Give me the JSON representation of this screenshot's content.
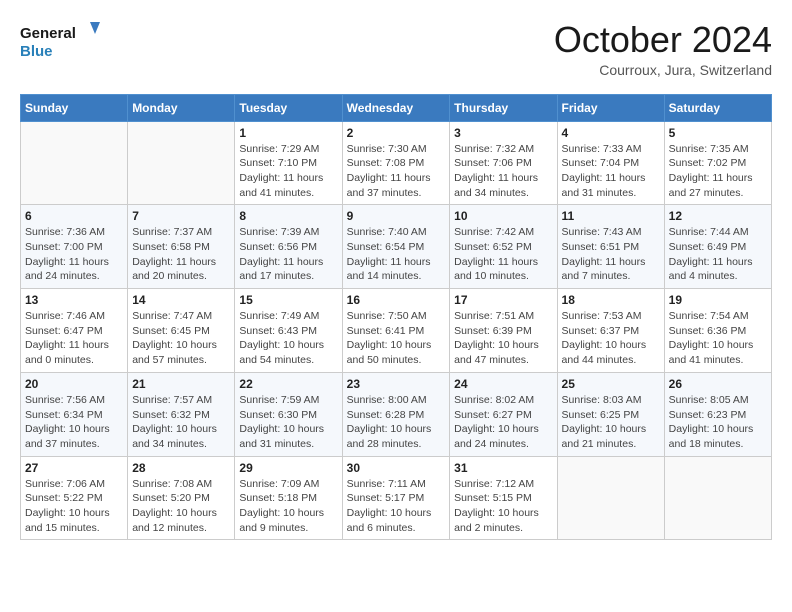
{
  "header": {
    "logo_line1": "General",
    "logo_line2": "Blue",
    "month": "October 2024",
    "location": "Courroux, Jura, Switzerland"
  },
  "weekdays": [
    "Sunday",
    "Monday",
    "Tuesday",
    "Wednesday",
    "Thursday",
    "Friday",
    "Saturday"
  ],
  "weeks": [
    [
      {
        "day": "",
        "info": ""
      },
      {
        "day": "",
        "info": ""
      },
      {
        "day": "1",
        "info": "Sunrise: 7:29 AM\nSunset: 7:10 PM\nDaylight: 11 hours and 41 minutes."
      },
      {
        "day": "2",
        "info": "Sunrise: 7:30 AM\nSunset: 7:08 PM\nDaylight: 11 hours and 37 minutes."
      },
      {
        "day": "3",
        "info": "Sunrise: 7:32 AM\nSunset: 7:06 PM\nDaylight: 11 hours and 34 minutes."
      },
      {
        "day": "4",
        "info": "Sunrise: 7:33 AM\nSunset: 7:04 PM\nDaylight: 11 hours and 31 minutes."
      },
      {
        "day": "5",
        "info": "Sunrise: 7:35 AM\nSunset: 7:02 PM\nDaylight: 11 hours and 27 minutes."
      }
    ],
    [
      {
        "day": "6",
        "info": "Sunrise: 7:36 AM\nSunset: 7:00 PM\nDaylight: 11 hours and 24 minutes."
      },
      {
        "day": "7",
        "info": "Sunrise: 7:37 AM\nSunset: 6:58 PM\nDaylight: 11 hours and 20 minutes."
      },
      {
        "day": "8",
        "info": "Sunrise: 7:39 AM\nSunset: 6:56 PM\nDaylight: 11 hours and 17 minutes."
      },
      {
        "day": "9",
        "info": "Sunrise: 7:40 AM\nSunset: 6:54 PM\nDaylight: 11 hours and 14 minutes."
      },
      {
        "day": "10",
        "info": "Sunrise: 7:42 AM\nSunset: 6:52 PM\nDaylight: 11 hours and 10 minutes."
      },
      {
        "day": "11",
        "info": "Sunrise: 7:43 AM\nSunset: 6:51 PM\nDaylight: 11 hours and 7 minutes."
      },
      {
        "day": "12",
        "info": "Sunrise: 7:44 AM\nSunset: 6:49 PM\nDaylight: 11 hours and 4 minutes."
      }
    ],
    [
      {
        "day": "13",
        "info": "Sunrise: 7:46 AM\nSunset: 6:47 PM\nDaylight: 11 hours and 0 minutes."
      },
      {
        "day": "14",
        "info": "Sunrise: 7:47 AM\nSunset: 6:45 PM\nDaylight: 10 hours and 57 minutes."
      },
      {
        "day": "15",
        "info": "Sunrise: 7:49 AM\nSunset: 6:43 PM\nDaylight: 10 hours and 54 minutes."
      },
      {
        "day": "16",
        "info": "Sunrise: 7:50 AM\nSunset: 6:41 PM\nDaylight: 10 hours and 50 minutes."
      },
      {
        "day": "17",
        "info": "Sunrise: 7:51 AM\nSunset: 6:39 PM\nDaylight: 10 hours and 47 minutes."
      },
      {
        "day": "18",
        "info": "Sunrise: 7:53 AM\nSunset: 6:37 PM\nDaylight: 10 hours and 44 minutes."
      },
      {
        "day": "19",
        "info": "Sunrise: 7:54 AM\nSunset: 6:36 PM\nDaylight: 10 hours and 41 minutes."
      }
    ],
    [
      {
        "day": "20",
        "info": "Sunrise: 7:56 AM\nSunset: 6:34 PM\nDaylight: 10 hours and 37 minutes."
      },
      {
        "day": "21",
        "info": "Sunrise: 7:57 AM\nSunset: 6:32 PM\nDaylight: 10 hours and 34 minutes."
      },
      {
        "day": "22",
        "info": "Sunrise: 7:59 AM\nSunset: 6:30 PM\nDaylight: 10 hours and 31 minutes."
      },
      {
        "day": "23",
        "info": "Sunrise: 8:00 AM\nSunset: 6:28 PM\nDaylight: 10 hours and 28 minutes."
      },
      {
        "day": "24",
        "info": "Sunrise: 8:02 AM\nSunset: 6:27 PM\nDaylight: 10 hours and 24 minutes."
      },
      {
        "day": "25",
        "info": "Sunrise: 8:03 AM\nSunset: 6:25 PM\nDaylight: 10 hours and 21 minutes."
      },
      {
        "day": "26",
        "info": "Sunrise: 8:05 AM\nSunset: 6:23 PM\nDaylight: 10 hours and 18 minutes."
      }
    ],
    [
      {
        "day": "27",
        "info": "Sunrise: 7:06 AM\nSunset: 5:22 PM\nDaylight: 10 hours and 15 minutes."
      },
      {
        "day": "28",
        "info": "Sunrise: 7:08 AM\nSunset: 5:20 PM\nDaylight: 10 hours and 12 minutes."
      },
      {
        "day": "29",
        "info": "Sunrise: 7:09 AM\nSunset: 5:18 PM\nDaylight: 10 hours and 9 minutes."
      },
      {
        "day": "30",
        "info": "Sunrise: 7:11 AM\nSunset: 5:17 PM\nDaylight: 10 hours and 6 minutes."
      },
      {
        "day": "31",
        "info": "Sunrise: 7:12 AM\nSunset: 5:15 PM\nDaylight: 10 hours and 2 minutes."
      },
      {
        "day": "",
        "info": ""
      },
      {
        "day": "",
        "info": ""
      }
    ]
  ]
}
